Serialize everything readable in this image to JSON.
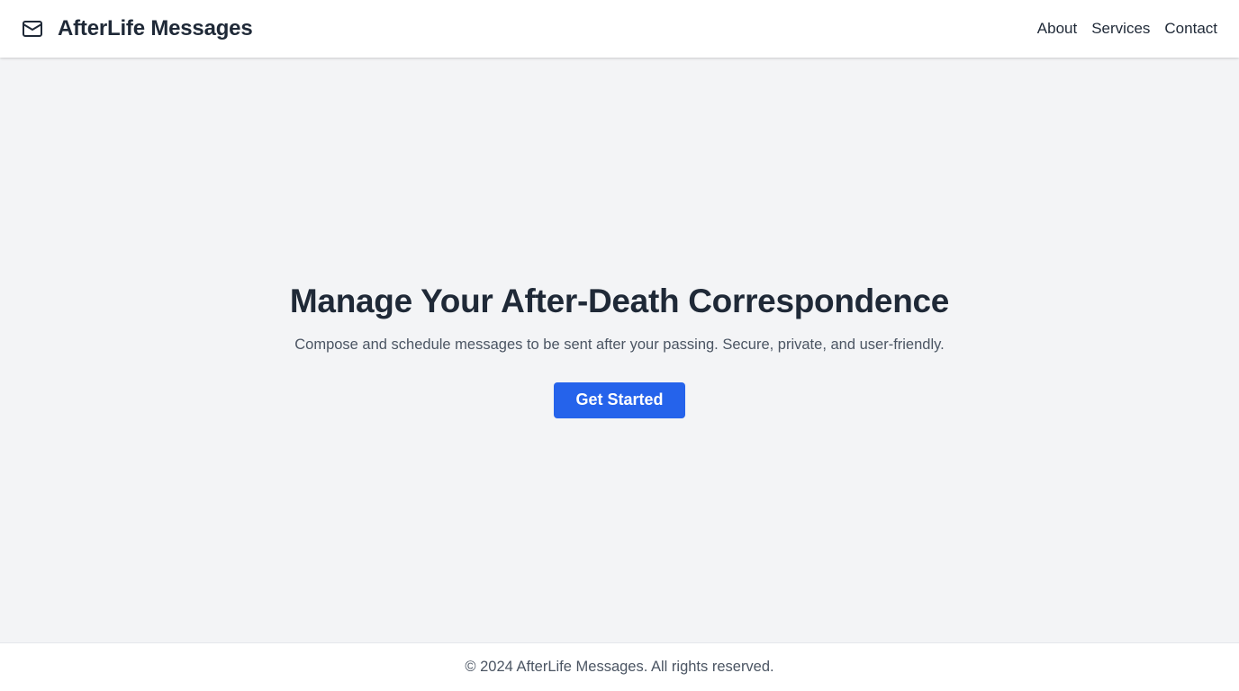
{
  "header": {
    "brand_icon": "mail-icon",
    "title": "AfterLife Messages",
    "nav": [
      {
        "label": "About"
      },
      {
        "label": "Services"
      },
      {
        "label": "Contact"
      }
    ]
  },
  "hero": {
    "title": "Manage Your After-Death Correspondence",
    "subtitle": "Compose and schedule messages to be sent after your passing. Secure, private, and user-friendly.",
    "cta_label": "Get Started"
  },
  "footer": {
    "text": "© 2024 AfterLife Messages. All rights reserved."
  },
  "colors": {
    "accent": "#2563eb",
    "text": "#1f2937",
    "muted": "#4b5563",
    "background": "#f3f4f6"
  }
}
